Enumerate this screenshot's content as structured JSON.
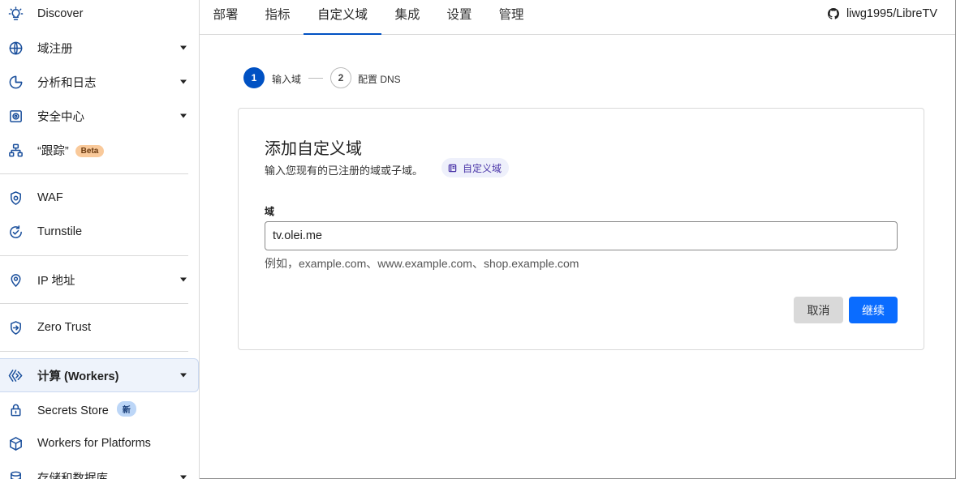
{
  "sidebar": {
    "items": [
      {
        "label": "Discover",
        "icon": "lightbulb-icon"
      },
      {
        "label": "域注册",
        "icon": "globe-icon"
      },
      {
        "label": "分析和日志",
        "icon": "chart-pie-icon"
      },
      {
        "label": "安全中心",
        "icon": "security-center-icon"
      },
      {
        "label": "“跟踪”",
        "icon": "hierarchy-icon",
        "badge": "Beta"
      },
      {
        "label": "WAF",
        "icon": "shield-gear-icon"
      },
      {
        "label": "Turnstile",
        "icon": "turnstile-check-icon"
      },
      {
        "label": "IP 地址",
        "icon": "map-pin-icon"
      },
      {
        "label": "Zero Trust",
        "icon": "zero-trust-shield-icon"
      },
      {
        "label": "计算 (Workers)",
        "icon": "workers-icon"
      },
      {
        "label": "Secrets Store",
        "icon": "lock-icon",
        "badge": "新"
      },
      {
        "label": "Workers for Platforms",
        "icon": "cube-icon"
      },
      {
        "label": "存储和数据库",
        "icon": "database-icon"
      }
    ]
  },
  "tabs": [
    "部署",
    "指标",
    "自定义域",
    "集成",
    "设置",
    "管理"
  ],
  "active_tab": "自定义域",
  "repo": {
    "icon": "github-icon",
    "name": "liwg1995/LibreTV"
  },
  "stepper": {
    "steps": [
      {
        "number": "1",
        "label": "输入域",
        "state": "active"
      },
      {
        "number": "2",
        "label": "配置 DNS",
        "state": "pending"
      }
    ]
  },
  "card": {
    "title": "添加自定义域",
    "subtitle": "输入您现有的已注册的域或子域。",
    "chip_label": "自定义域",
    "chip_icon": "docs-book-icon",
    "field_label": "域",
    "input_value": "tv.olei.me",
    "hint": "例如，example.com、www.example.com、shop.example.com",
    "cancel_label": "取消",
    "continue_label": "继续"
  },
  "colors": {
    "accent": "#0051c3",
    "primary_button": "#0a6cff",
    "icon": "#1a4f9c",
    "beta_badge": "#f9c99a",
    "new_badge": "#bcd6f7",
    "chip_bg": "#eef0fb"
  }
}
